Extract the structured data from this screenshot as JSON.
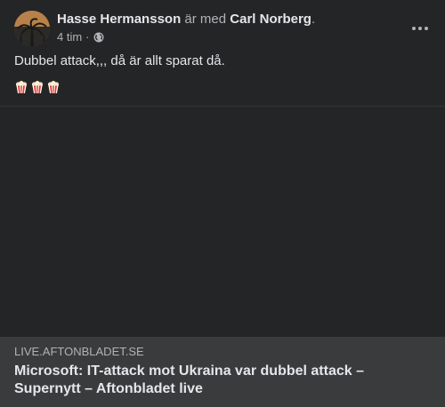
{
  "post": {
    "author": "Hasse Hermansson",
    "with_text": "är med",
    "tagged": "Carl Norberg",
    "punctuation": ".",
    "time": "4 tim",
    "separator": "·",
    "privacy_icon": "globe-icon",
    "more_icon": "more-options-icon",
    "text": "Dubbel attack,,, då är allt sparat då.",
    "emojis": [
      "popcorn",
      "popcorn",
      "popcorn"
    ]
  },
  "link_preview": {
    "domain": "LIVE.AFTONBLADET.SE",
    "title": "Microsoft: IT-attack mot Ukraina var dubbel attack – Supernytt – Aftonbladet live"
  },
  "colors": {
    "background": "#242526",
    "text_primary": "#e4e6eb",
    "text_secondary": "#b0b3b8",
    "link_background": "#3a3b3c"
  }
}
